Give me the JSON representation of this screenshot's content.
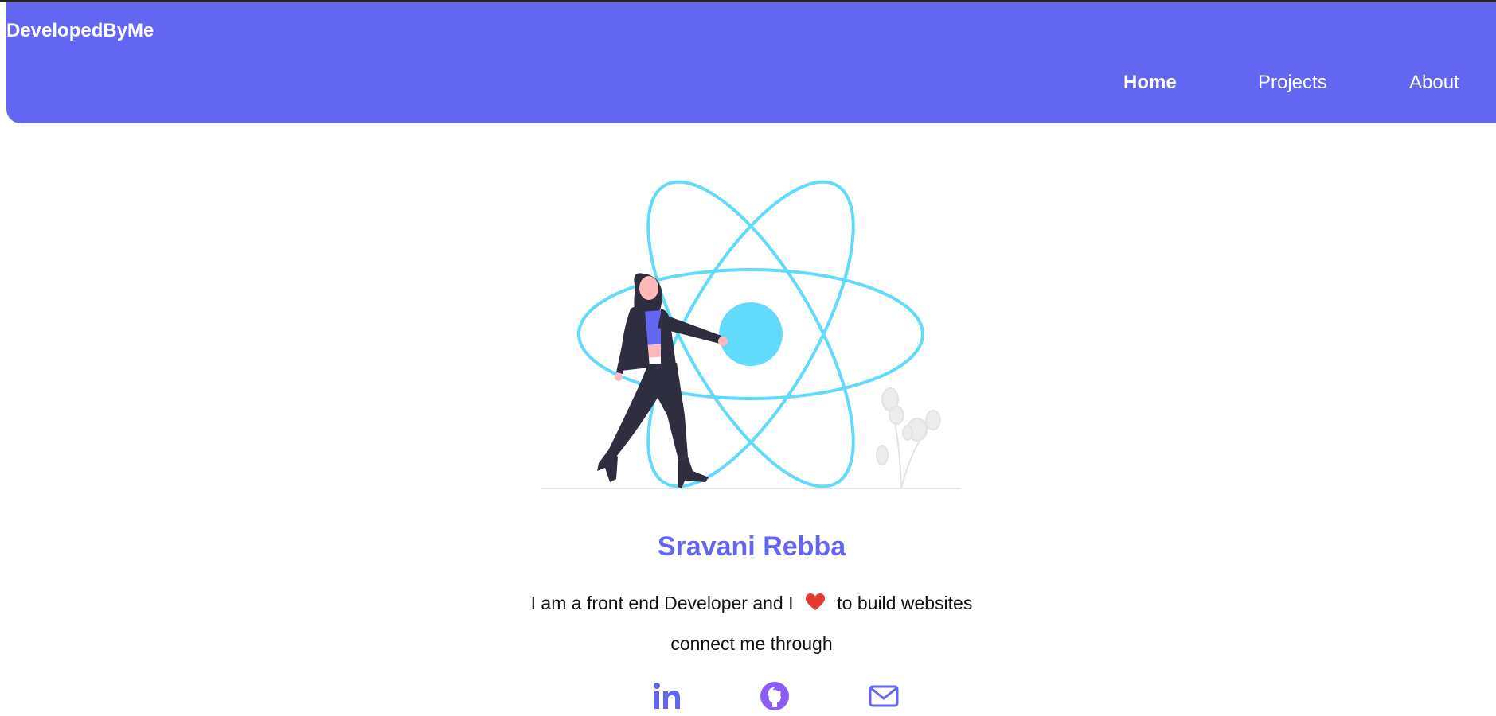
{
  "colors": {
    "accent": "#6366f1",
    "react_blue": "#61dafb",
    "github": "#8b5cf6",
    "text": "#111111"
  },
  "navbar": {
    "brand": "DevelopedByMe",
    "links": [
      {
        "label": "Home",
        "active": true
      },
      {
        "label": "Projects",
        "active": false
      },
      {
        "label": "About",
        "active": false
      }
    ]
  },
  "hero": {
    "illustration": "woman-with-react-atom-illustration",
    "name": "Sravani Rebba",
    "tagline_before": "I am a front end Developer and I",
    "tagline_icon": "heart-icon",
    "tagline_after": "to build websites",
    "connect_text": "connect me through"
  },
  "social": [
    {
      "icon": "linkedin-icon"
    },
    {
      "icon": "github-icon"
    },
    {
      "icon": "email-icon"
    }
  ]
}
